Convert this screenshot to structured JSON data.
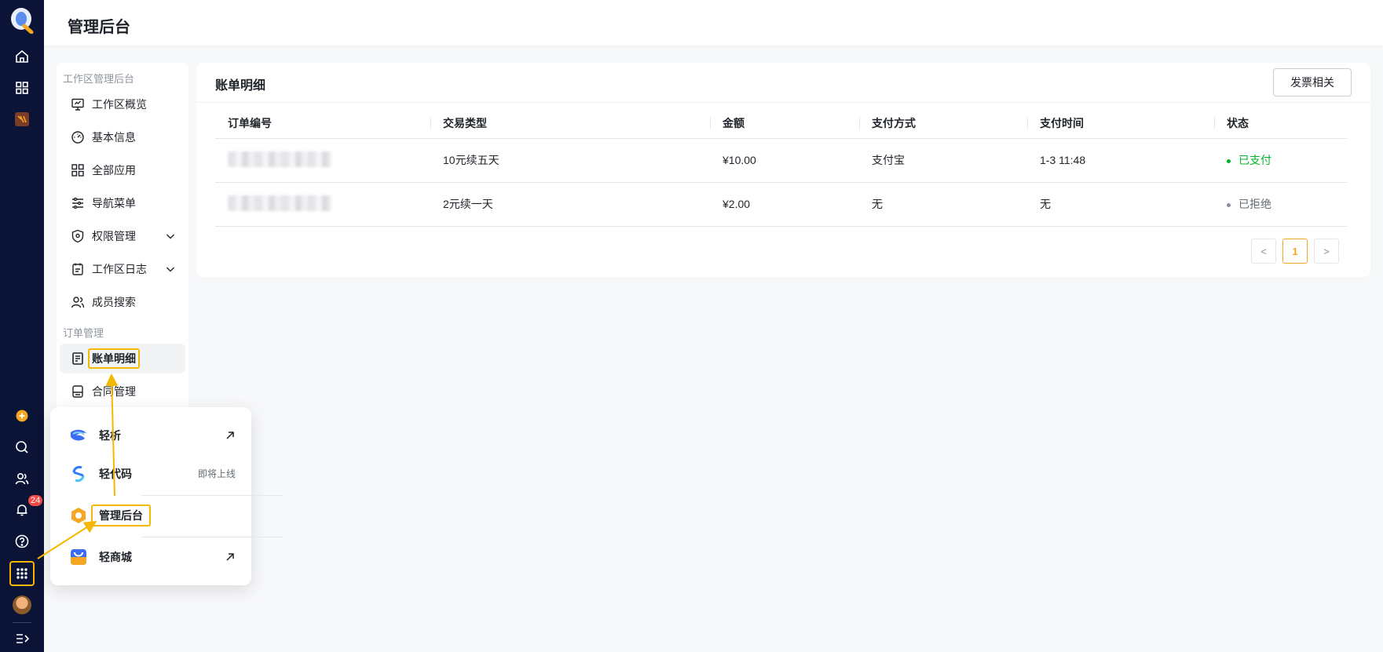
{
  "header": {
    "title": "管理后台"
  },
  "rail": {
    "notification_count": "24"
  },
  "side_menu": {
    "group_workspace": "工作区管理后台",
    "items_workspace": [
      {
        "label": "工作区概览",
        "icon": "monitor-icon"
      },
      {
        "label": "基本信息",
        "icon": "gauge-icon"
      },
      {
        "label": "全部应用",
        "icon": "grid-icon"
      },
      {
        "label": "导航菜单",
        "icon": "sliders-icon"
      },
      {
        "label": "权限管理",
        "icon": "shield-icon"
      },
      {
        "label": "工作区日志",
        "icon": "calendar-icon"
      },
      {
        "label": "成员搜索",
        "icon": "users-icon"
      }
    ],
    "group_orders": "订单管理",
    "items_orders": [
      {
        "label": "账单明细",
        "icon": "bill-icon",
        "active": true
      },
      {
        "label": "合同管理",
        "icon": "contract-icon"
      }
    ]
  },
  "main": {
    "title": "账单明细",
    "invoice_button": "发票相关",
    "columns": [
      "订单编号",
      "交易类型",
      "金额",
      "支付方式",
      "支付时间",
      "状态"
    ],
    "rows": [
      {
        "type": "10元续五天",
        "amount": "¥10.00",
        "method": "支付宝",
        "time": "1-3 11:48",
        "status": "已支付",
        "status_color": "#00b42a"
      },
      {
        "type": "2元续一天",
        "amount": "¥2.00",
        "method": "无",
        "time": "无",
        "status": "已拒绝",
        "status_color": "#86909c"
      }
    ],
    "pagination": {
      "prev": "<",
      "current": "1",
      "next": ">"
    }
  },
  "popup": {
    "items": [
      {
        "label": "轻析",
        "icon": "qingxi-icon",
        "external": true
      },
      {
        "label": "轻代码",
        "icon": "qingdaima-icon",
        "note": "即将上线"
      },
      {
        "label": "管理后台",
        "icon": "admin-hexagon-icon",
        "highlighted": true
      },
      {
        "label": "轻商城",
        "icon": "mall-icon",
        "external": true
      }
    ]
  },
  "colors": {
    "accent": "#f5a623",
    "highlight": "#f5b800",
    "rail_bg": "#0b1437",
    "success": "#00b42a"
  }
}
